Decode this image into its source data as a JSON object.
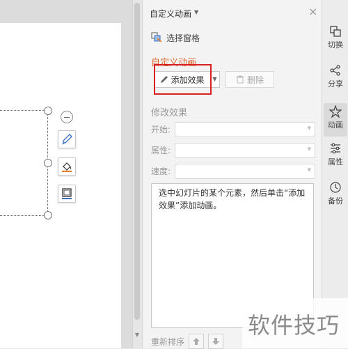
{
  "panel": {
    "title": "自定义动画",
    "select_pane_label": "选择窗格",
    "custom_animation_heading": "自定义动画",
    "add_effect_label": "添加效果",
    "delete_label": "删除",
    "modify_effect_heading": "修改效果",
    "start_label": "开始:",
    "property_label": "属性:",
    "speed_label": "速度:",
    "start_value": "",
    "property_value": "",
    "speed_value": "",
    "hint_text": "选中幻灯片的某个元素，然后单击“添加效果”添加动画。",
    "reorder_label": "重新排序"
  },
  "sidebar": {
    "items": [
      {
        "label": "切换",
        "icon": "transition-icon"
      },
      {
        "label": "分享",
        "icon": "share-icon"
      },
      {
        "label": "动画",
        "icon": "animation-star-icon",
        "active": true
      },
      {
        "label": "属性",
        "icon": "properties-sliders-icon"
      },
      {
        "label": "备份",
        "icon": "backup-clock-icon"
      }
    ]
  },
  "floating_tools": [
    "shape-style-brush-icon",
    "fill-bucket-icon",
    "outline-icon"
  ],
  "watermark": {
    "text": "软件技巧"
  },
  "colors": {
    "accent_heading": "#e0652c",
    "highlight_border": "#d92020",
    "panel_bg": "#f3f3f3"
  }
}
